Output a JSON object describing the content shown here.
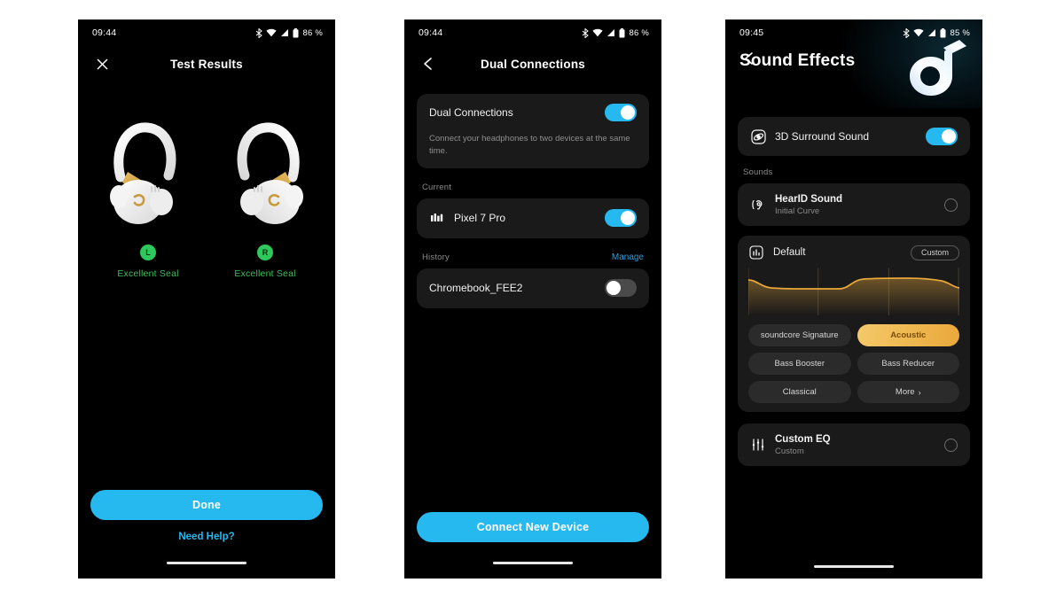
{
  "colors": {
    "accent_blue": "#25b9f0",
    "seal_green": "#3bbf5e",
    "eq_orange": "#e9a83a",
    "card_bg": "#1a1a1a",
    "screen_bg": "#000000"
  },
  "screens": [
    {
      "id": "test-results",
      "status": {
        "time": "09:44",
        "battery": "86 %",
        "icons": [
          "bluetooth-icon",
          "wifi-icon",
          "signal-icon",
          "battery-icon"
        ]
      },
      "nav": {
        "left_icon": "close-icon",
        "title": "Test Results"
      },
      "buds": [
        {
          "side": "L",
          "badge": "L",
          "seal_text": "Excellent Seal"
        },
        {
          "side": "R",
          "badge": "R",
          "seal_text": "Excellent Seal"
        }
      ],
      "primary_button": "Done",
      "help_link": "Need Help?"
    },
    {
      "id": "dual-connections",
      "status": {
        "time": "09:44",
        "battery": "86 %",
        "icons": [
          "bluetooth-icon",
          "wifi-icon",
          "signal-icon",
          "battery-icon"
        ]
      },
      "nav": {
        "left_icon": "back-chevron-icon",
        "title": "Dual Connections"
      },
      "main_card": {
        "title": "Dual Connections",
        "toggle_state": "on",
        "description": "Connect your headphones to two devices at the same time."
      },
      "current": {
        "label": "Current",
        "device": {
          "name": "Pixel 7 Pro",
          "icon": "phone-signal-icon",
          "toggle_state": "on"
        }
      },
      "history": {
        "label": "History",
        "manage_link": "Manage",
        "device": {
          "name": "Chromebook_FEE2",
          "toggle_state": "off"
        }
      },
      "primary_button": "Connect New Device"
    },
    {
      "id": "sound-effects",
      "status": {
        "time": "09:45",
        "battery": "85 %",
        "icons": [
          "bluetooth-icon",
          "wifi-icon",
          "signal-icon",
          "battery-icon"
        ]
      },
      "nav": {
        "left_icon": "back-chevron-icon"
      },
      "hero": {
        "title": "Sound Effects",
        "logo": "soundcore-logo"
      },
      "surround": {
        "label": "3D Surround Sound",
        "icon": "surround-sound-icon",
        "toggle_state": "on"
      },
      "sounds_label": "Sounds",
      "hearid": {
        "title": "HearID Sound",
        "subtitle": "Initial Curve",
        "icon": "hearid-ear-icon",
        "selected": false
      },
      "eq": {
        "name": "Default",
        "icon": "equalizer-icon",
        "custom_pill": "Custom",
        "presets": [
          {
            "label": "soundcore Signature",
            "active": false
          },
          {
            "label": "Acoustic",
            "active": true
          },
          {
            "label": "Bass Booster",
            "active": false
          },
          {
            "label": "Bass Reducer",
            "active": false
          },
          {
            "label": "Classical",
            "active": false
          },
          {
            "label": "More",
            "active": false,
            "chevron": "›"
          }
        ]
      },
      "custom_eq": {
        "title": "Custom EQ",
        "subtitle": "Custom",
        "icon": "sliders-icon",
        "selected": false
      }
    }
  ],
  "chart_data": {
    "type": "line",
    "title": "Default EQ Curve",
    "xlabel": "",
    "ylabel": "",
    "grid": true,
    "x": [
      0,
      1,
      2,
      3,
      4,
      5,
      6,
      7,
      8,
      9,
      10
    ],
    "values": [
      62,
      50,
      46,
      47,
      46,
      46,
      60,
      63,
      63,
      62,
      50
    ],
    "ylim": [
      0,
      100
    ],
    "legend": "none",
    "line_color": "#e9a83a",
    "fill": "gradient-orange"
  }
}
